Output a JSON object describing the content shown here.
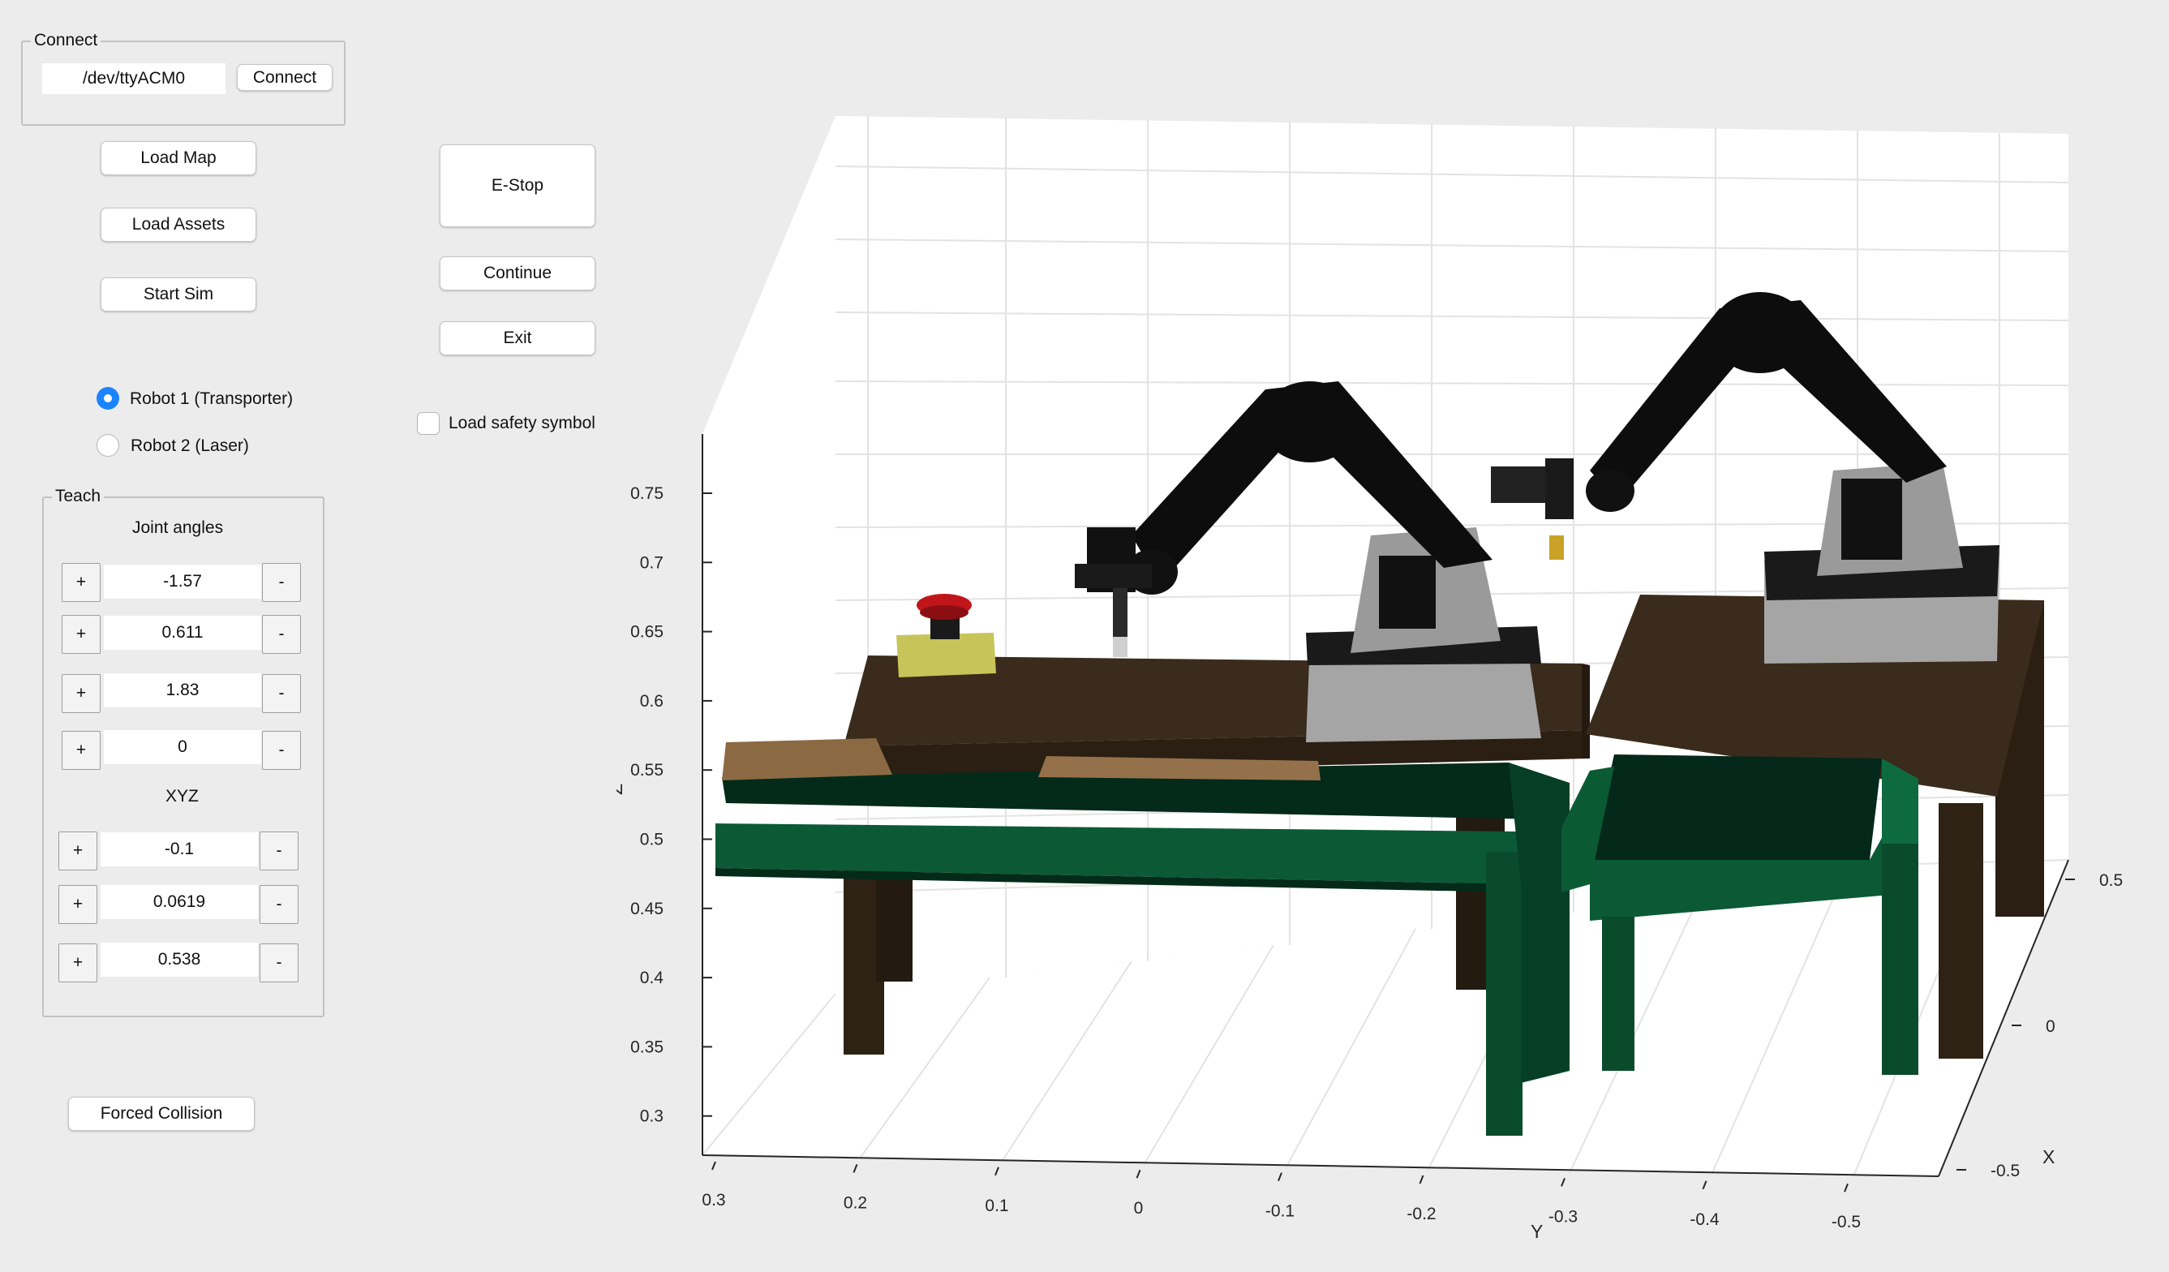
{
  "connect": {
    "title": "Connect",
    "port_value": "/dev/ttyACM0",
    "connect_label": "Connect"
  },
  "buttons": {
    "load_map": "Load Map",
    "load_assets": "Load Assets",
    "start_sim": "Start Sim",
    "estop": "E-Stop",
    "continue": "Continue",
    "exit": "Exit",
    "forced_collision": "Forced Collision"
  },
  "robots": {
    "selected": 0,
    "options": [
      {
        "label": "Robot 1 (Transporter)"
      },
      {
        "label": "Robot 2 (Laser)"
      }
    ]
  },
  "safety": {
    "label": "Load safety symbol",
    "checked": false
  },
  "teach": {
    "title": "Teach",
    "joint_heading": "Joint angles",
    "joints": [
      {
        "value": "-1.57"
      },
      {
        "value": "0.611"
      },
      {
        "value": "1.83"
      },
      {
        "value": "0"
      }
    ],
    "xyz_heading": "XYZ",
    "xyz": [
      {
        "value": "-0.1"
      },
      {
        "value": "0.0619"
      },
      {
        "value": "0.538"
      }
    ],
    "plus_label": "+",
    "minus_label": "-"
  },
  "plot": {
    "z_label": "Z",
    "y_label": "Y",
    "x_label": "X",
    "z_ticks": [
      "0.75",
      "0.7",
      "0.65",
      "0.6",
      "0.55",
      "0.5",
      "0.45",
      "0.4",
      "0.35",
      "0.3"
    ],
    "y_ticks": [
      "0.3",
      "0.2",
      "0.1",
      "0",
      "-0.1",
      "-0.2",
      "-0.3",
      "-0.4",
      "-0.5"
    ],
    "x_ticks": [
      "0.5",
      "0",
      "-0.5"
    ]
  },
  "colors": {
    "table_top": "#3a2b1c",
    "table_leg": "#2e2215",
    "rail_green": "#0b5a35",
    "robot_black": "#0d0d0d",
    "robot_grey": "#9a9a9a",
    "estop_red": "#c0161b",
    "estop_base": "#c7c45a",
    "radio_accent": "#1a84ff"
  }
}
